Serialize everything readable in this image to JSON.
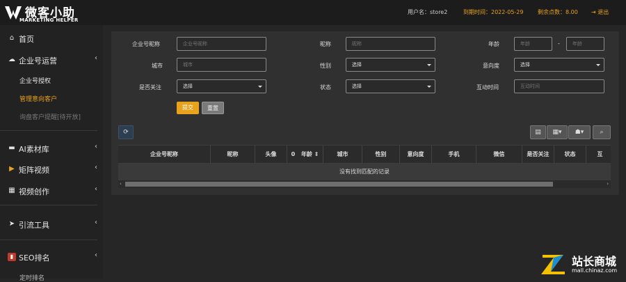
{
  "brand": {
    "title": "微客小助",
    "subtitle": "MARKETING HELPER"
  },
  "topbar": {
    "username": "用户名：store2",
    "expire": "到期时间：2022-05-29",
    "points": "剩余点数：8.00",
    "logout": "退出"
  },
  "sidebar": {
    "home": "首页",
    "enterprise": "企业号运营",
    "enterprise_sub": [
      "企业号授权",
      "管理意向客户",
      "询盘客户提醒[待开放]"
    ],
    "ai_library": "AI素材库",
    "matrix_video": "矩阵视频",
    "video_creation": "视频创作",
    "traffic_tools": "引流工具",
    "seo": "SEO排名",
    "seo_sub": "定时排名"
  },
  "filters": {
    "nickname_label": "企业号昵称",
    "nickname_placeholder": "企业号昵称",
    "name_label": "昵称",
    "name_placeholder": "昵称",
    "age_label": "年龄",
    "age_min_placeholder": "年龄",
    "age_sep": "-",
    "age_max_placeholder": "年龄",
    "city_label": "城市",
    "city_placeholder": "城市",
    "gender_label": "性别",
    "gender_value": "选择",
    "intent_label": "意向度",
    "intent_value": "选择",
    "follow_label": "是否关注",
    "follow_value": "选择",
    "status_label": "状态",
    "status_value": "选择",
    "interaction_label": "互动时间",
    "interaction_placeholder": "互动时间",
    "submit": "提交",
    "reset": "重置"
  },
  "table": {
    "columns": [
      "企业号昵称",
      "昵称",
      "头像",
      "年龄",
      "城市",
      "性别",
      "意向度",
      "手机",
      "微信",
      "是否关注",
      "状态",
      "互"
    ],
    "sort_prefix": "0",
    "empty_message": "没有找到匹配的记录"
  },
  "watermark": {
    "text": "站长商城",
    "url": "mall.chinaz.com"
  },
  "colors": {
    "accent": "#e8a21c",
    "expire_color": "#e8a21c",
    "points_color": "#e8a21c",
    "logout_color": "#e8a21c",
    "active_menu": "#e8a21c",
    "refresh_button": "#2c3e50"
  }
}
